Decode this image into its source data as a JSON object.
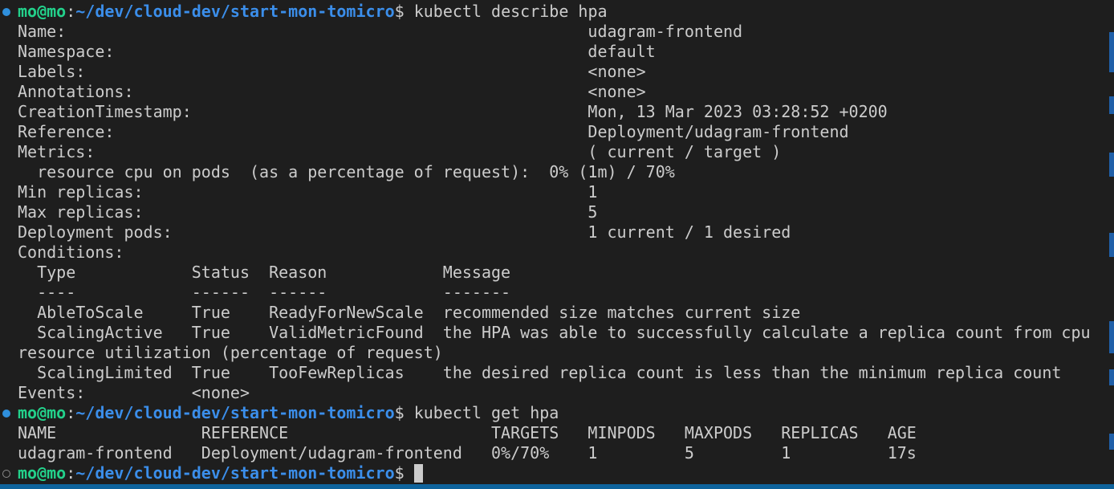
{
  "prompt": {
    "user": "mo@mo",
    "sep": ":",
    "path": "~/dev/cloud-dev/start-mon-tomicro",
    "symbol": "$"
  },
  "lines": [
    {
      "type": "prompt",
      "marker": "done",
      "command": " kubectl describe hpa"
    },
    {
      "type": "text",
      "text": "Name:                                                      udagram-frontend"
    },
    {
      "type": "text",
      "text": "Namespace:                                                 default"
    },
    {
      "type": "text",
      "text": "Labels:                                                    <none>"
    },
    {
      "type": "text",
      "text": "Annotations:                                               <none>"
    },
    {
      "type": "text",
      "text": "CreationTimestamp:                                         Mon, 13 Mar 2023 03:28:52 +0200"
    },
    {
      "type": "text",
      "text": "Reference:                                                 Deployment/udagram-frontend"
    },
    {
      "type": "text",
      "text": "Metrics:                                                   ( current / target )"
    },
    {
      "type": "text",
      "text": "  resource cpu on pods  (as a percentage of request):  0% (1m) / 70%"
    },
    {
      "type": "text",
      "text": "Min replicas:                                              1"
    },
    {
      "type": "text",
      "text": "Max replicas:                                              5"
    },
    {
      "type": "text",
      "text": "Deployment pods:                                           1 current / 1 desired"
    },
    {
      "type": "text",
      "text": "Conditions:"
    },
    {
      "type": "text",
      "text": "  Type            Status  Reason            Message"
    },
    {
      "type": "text",
      "text": "  ----            ------  ------            -------"
    },
    {
      "type": "text",
      "text": "  AbleToScale     True    ReadyForNewScale  recommended size matches current size"
    },
    {
      "type": "text",
      "text": "  ScalingActive   True    ValidMetricFound  the HPA was able to successfully calculate a replica count from cpu"
    },
    {
      "type": "text",
      "text": "resource utilization (percentage of request)"
    },
    {
      "type": "text",
      "text": "  ScalingLimited  True    TooFewReplicas    the desired replica count is less than the minimum replica count"
    },
    {
      "type": "text",
      "text": "Events:           <none>"
    },
    {
      "type": "prompt",
      "marker": "done",
      "command": " kubectl get hpa"
    },
    {
      "type": "text",
      "text": "NAME               REFERENCE                     TARGETS   MINPODS   MAXPODS   REPLICAS   AGE"
    },
    {
      "type": "text",
      "text": "udagram-frontend   Deployment/udagram-frontend   0%/70%    1         5         1          17s"
    },
    {
      "type": "prompt",
      "marker": "pending",
      "command": " ",
      "cursor": true
    }
  ],
  "colors": {
    "background": "#1e1e1e",
    "text": "#cccccc",
    "user": "#23d18b",
    "path": "#3b8eea",
    "marker_done": "#2f8fdc",
    "accent_bar": "#0e639c"
  }
}
